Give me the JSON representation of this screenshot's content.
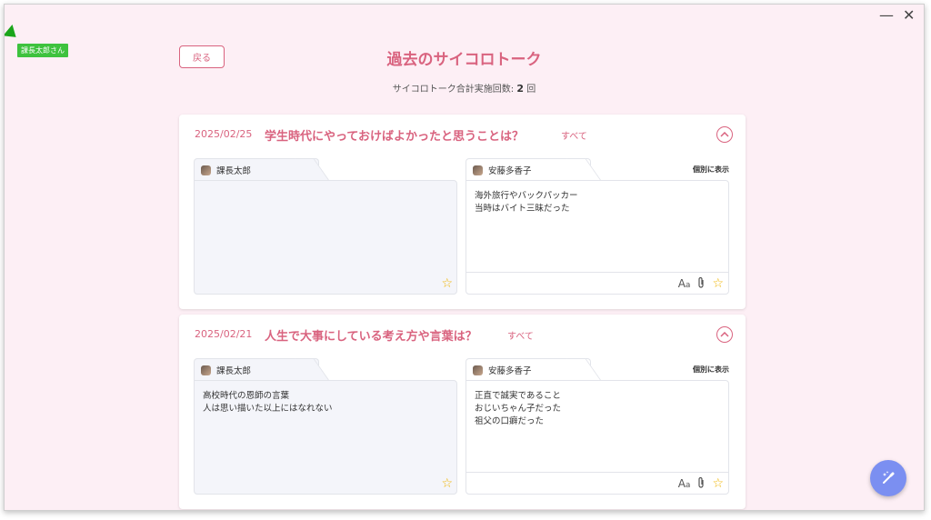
{
  "window": {
    "minimize_label": "—",
    "close_label": "✕"
  },
  "user_tag": "課長太郎さん",
  "header": {
    "back_label": "戻る",
    "title": "過去のサイコロトーク",
    "summary_label": "サイコロトーク合計実施回数:",
    "summary_count": "2",
    "summary_unit": "回"
  },
  "sessions": [
    {
      "date": "2025/02/25",
      "question": "学生時代にやっておけばよかったと思うことは？",
      "all_label": "すべて",
      "left": {
        "name": "課長太郎",
        "answer": ""
      },
      "right": {
        "name": "安藤多香子",
        "answer": "海外旅行やバックパッカー\n当時はバイト三昧だった",
        "individual_label": "個別に表示"
      }
    },
    {
      "date": "2025/02/21",
      "question": "人生で大事にしている考え方や言葉は？",
      "all_label": "すべて",
      "left": {
        "name": "課長太郎",
        "answer": "高校時代の恩師の言葉\n人は思い描いた以上にはなれない"
      },
      "right": {
        "name": "安藤多香子",
        "answer": "正直で誠実であること\nおじいちゃん子だった\n祖父の口癖だった",
        "individual_label": "個別に表示"
      }
    }
  ],
  "toolbar": {
    "font_label": "A",
    "font_small": "a"
  },
  "icons": {
    "star": "star-icon",
    "clip": "paperclip-icon",
    "fab": "magic-pen-icon",
    "collapse": "chevron-up-icon"
  },
  "colors": {
    "accent": "#d9637f",
    "background": "#fdeff5",
    "fab": "#7b8ff1",
    "star": "#f0b400"
  }
}
